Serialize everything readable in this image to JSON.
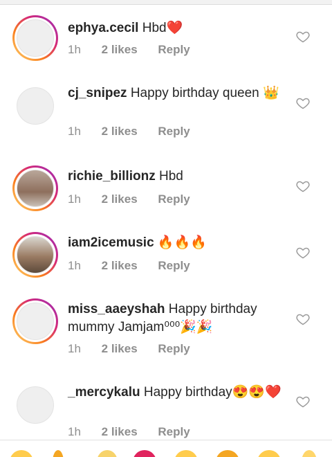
{
  "comments": [
    {
      "username": "ephya.cecil",
      "text": "Hbd❤️",
      "time": "1h",
      "likes": "2 likes",
      "reply": "Reply",
      "avatar_ring": true
    },
    {
      "username": "cj_snipez",
      "text": "Happy birthday queen 👑",
      "time": "1h",
      "likes": "2 likes",
      "reply": "Reply",
      "avatar_ring": false
    },
    {
      "username": "richie_billionz",
      "text": "Hbd",
      "time": "1h",
      "likes": "2 likes",
      "reply": "Reply",
      "avatar_ring": true
    },
    {
      "username": "iam2icemusic",
      "text": "🔥🔥🔥",
      "time": "1h",
      "likes": "2 likes",
      "reply": "Reply",
      "avatar_ring": true
    },
    {
      "username": "miss_aaeyshah",
      "text": "Happy birthday mummy Jamjam⁰⁰⁰🎉🎉",
      "time": "1h",
      "likes": "2 likes",
      "reply": "Reply",
      "avatar_ring": true
    },
    {
      "username": "_mercykalu",
      "text": "Happy birthday😍😍❤️",
      "time": "1h",
      "likes": "2 likes",
      "reply": "Reply",
      "avatar_ring": false
    }
  ],
  "icons": {
    "like": "heart-outline-icon"
  },
  "colors": {
    "ring_start": "#feda75",
    "ring_end": "#962fbf",
    "meta": "#8e8e8e",
    "text": "#262626"
  }
}
